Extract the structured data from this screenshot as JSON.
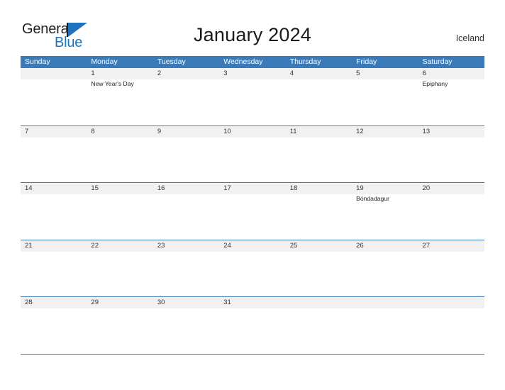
{
  "brand": {
    "name_part1": "General",
    "name_part2": "Blue",
    "flag_icon": "triangle-flag-icon",
    "color_primary": "#1f72bc",
    "color_text": "#231f20"
  },
  "header": {
    "title": "January 2024",
    "country": "Iceland"
  },
  "calendar": {
    "month": "January",
    "year": "2024",
    "accent_color": "#3a7ab8",
    "band_color": "#f1f1f1",
    "weekdays": [
      "Sunday",
      "Monday",
      "Tuesday",
      "Wednesday",
      "Thursday",
      "Friday",
      "Saturday"
    ],
    "weeks": [
      [
        {
          "day": ""
        },
        {
          "day": "1",
          "event": "New Year's Day"
        },
        {
          "day": "2",
          "event": ""
        },
        {
          "day": "3",
          "event": ""
        },
        {
          "day": "4",
          "event": ""
        },
        {
          "day": "5",
          "event": ""
        },
        {
          "day": "6",
          "event": "Epiphany"
        }
      ],
      [
        {
          "day": "7",
          "event": ""
        },
        {
          "day": "8",
          "event": ""
        },
        {
          "day": "9",
          "event": ""
        },
        {
          "day": "10",
          "event": ""
        },
        {
          "day": "11",
          "event": ""
        },
        {
          "day": "12",
          "event": ""
        },
        {
          "day": "13",
          "event": ""
        }
      ],
      [
        {
          "day": "14",
          "event": ""
        },
        {
          "day": "15",
          "event": ""
        },
        {
          "day": "16",
          "event": ""
        },
        {
          "day": "17",
          "event": ""
        },
        {
          "day": "18",
          "event": ""
        },
        {
          "day": "19",
          "event": "Bóndadagur"
        },
        {
          "day": "20",
          "event": ""
        }
      ],
      [
        {
          "day": "21",
          "event": ""
        },
        {
          "day": "22",
          "event": ""
        },
        {
          "day": "23",
          "event": ""
        },
        {
          "day": "24",
          "event": ""
        },
        {
          "day": "25",
          "event": ""
        },
        {
          "day": "26",
          "event": ""
        },
        {
          "day": "27",
          "event": ""
        }
      ],
      [
        {
          "day": "28",
          "event": ""
        },
        {
          "day": "29",
          "event": ""
        },
        {
          "day": "30",
          "event": ""
        },
        {
          "day": "31",
          "event": ""
        },
        {
          "day": ""
        },
        {
          "day": ""
        },
        {
          "day": ""
        }
      ]
    ]
  }
}
